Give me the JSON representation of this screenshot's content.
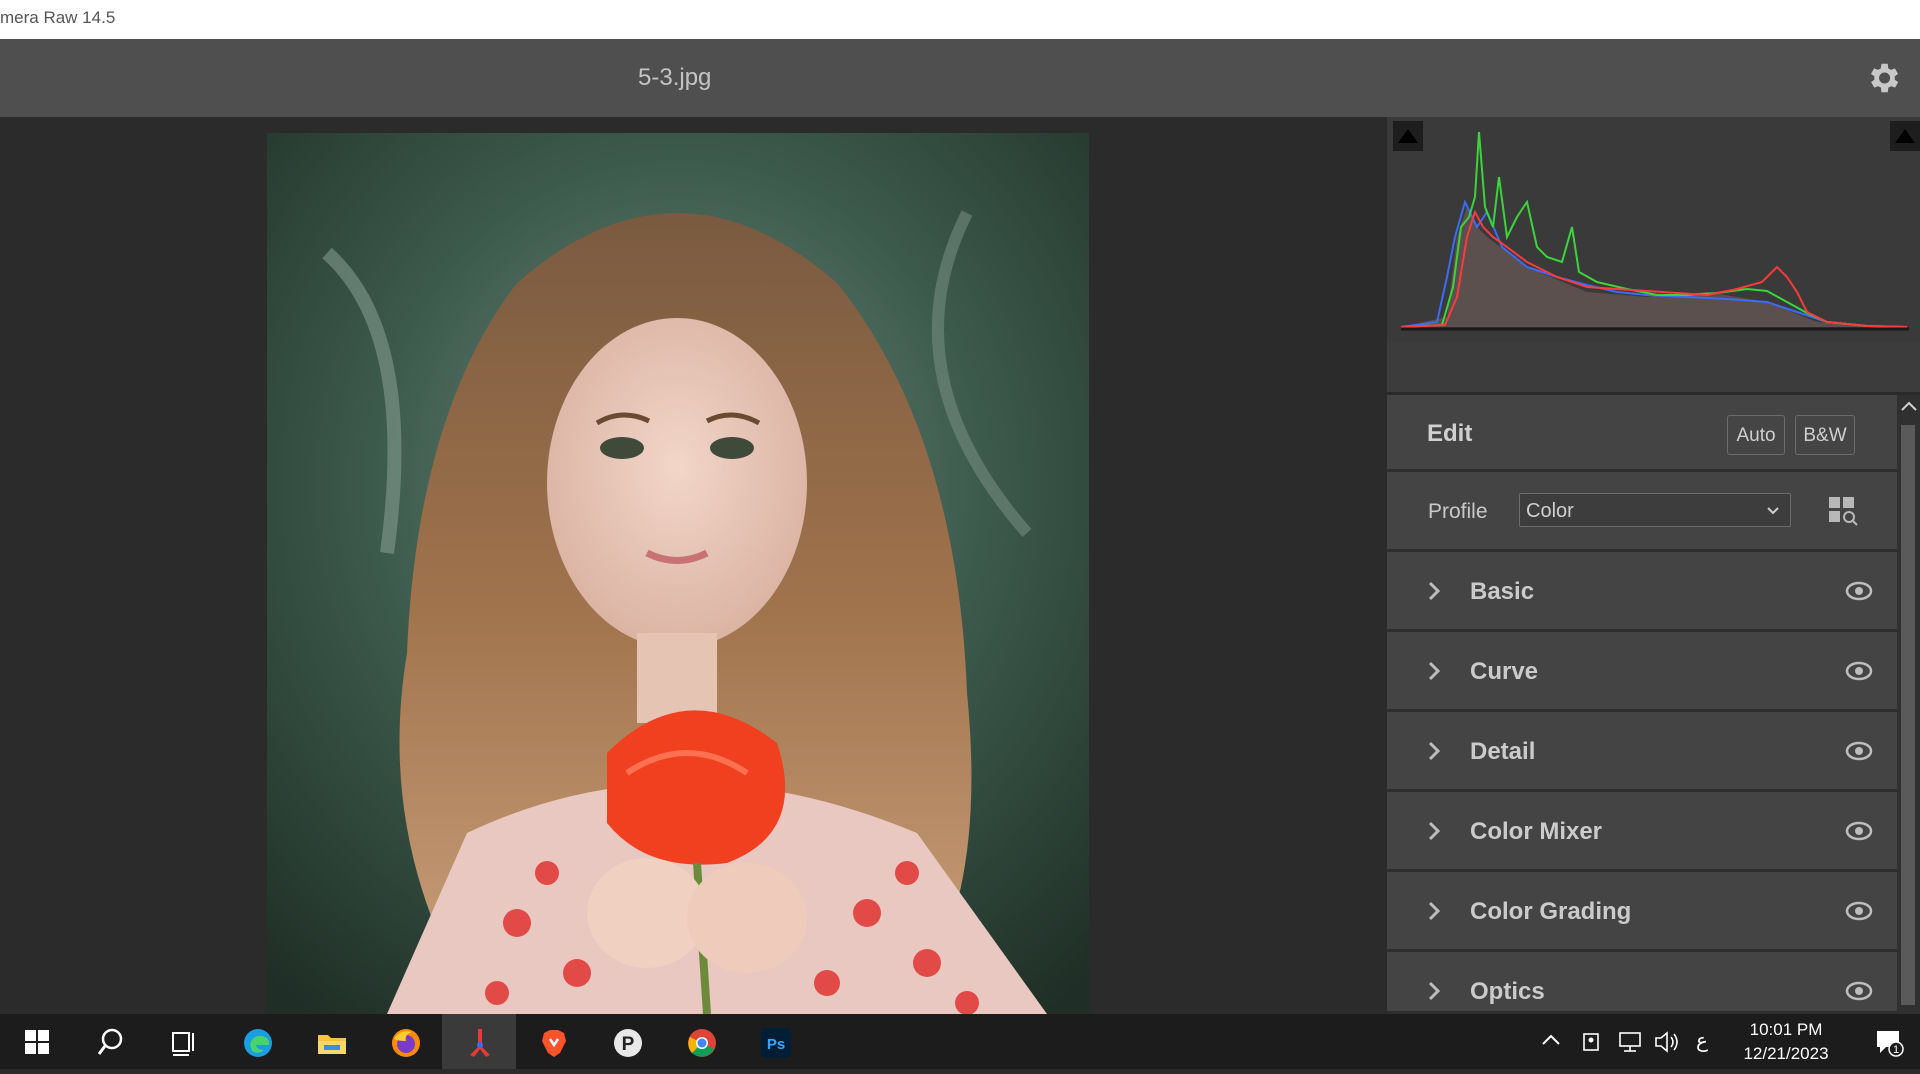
{
  "os_window": {
    "title": "mera Raw 14.5"
  },
  "header": {
    "filename": "5-3.jpg",
    "settings_icon": "gear-icon"
  },
  "panel": {
    "edit": {
      "title": "Edit",
      "auto_label": "Auto",
      "bw_label": "B&W"
    },
    "profile": {
      "label": "Profile",
      "value": "Color",
      "browse_icon": "grid-search-icon"
    },
    "sections": [
      {
        "label": "Basic"
      },
      {
        "label": "Curve"
      },
      {
        "label": "Detail"
      },
      {
        "label": "Color Mixer"
      },
      {
        "label": "Color Grading"
      },
      {
        "label": "Optics"
      }
    ]
  },
  "taskbar": {
    "apps": [
      "windows-start",
      "search",
      "task-view",
      "edge",
      "file-explorer",
      "firefox",
      "app-red-tool",
      "brave",
      "app-p",
      "chrome",
      "photoshop"
    ],
    "photoshop_label": "Ps",
    "p_app_label": "P",
    "tray_lang": "ع",
    "time": "10:01 PM",
    "date": "12/21/2023",
    "notification_count": "1"
  },
  "colors": {
    "accent_red": "#ff3b3b",
    "accent_green": "#3bd43b",
    "accent_blue": "#3b6bff"
  }
}
